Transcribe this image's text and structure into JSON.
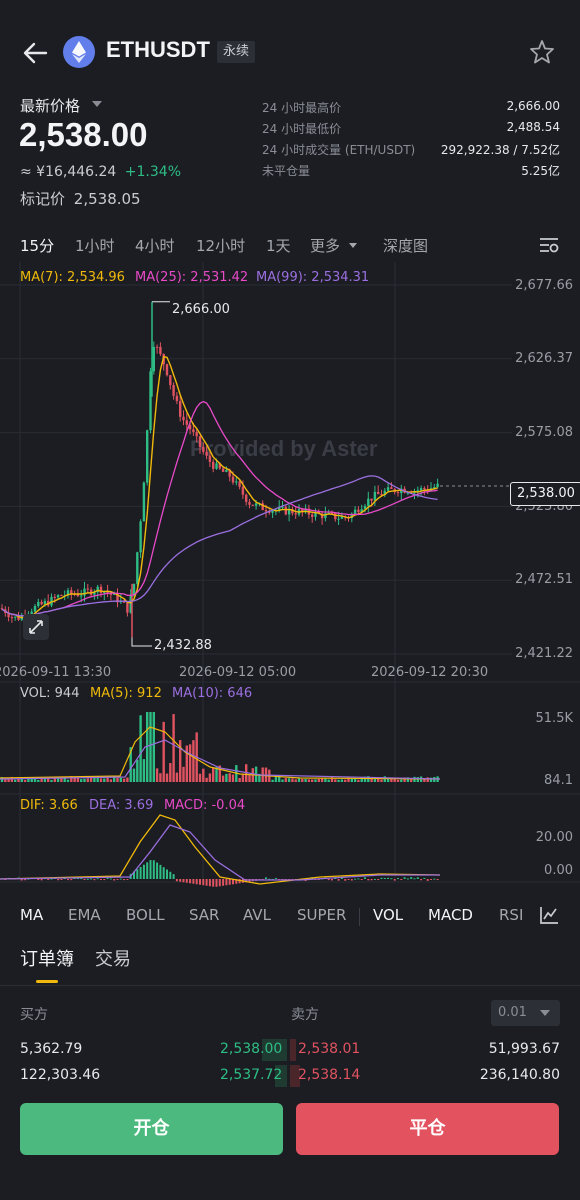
{
  "header": {
    "symbol": "ETHUSDT",
    "badge": "永续"
  },
  "price": {
    "latest_label": "最新价格",
    "last": "2,538.00",
    "cny": "≈ ¥16,446.24",
    "change_pct": "+1.34%",
    "mark_label": "标记价",
    "mark_value": "2,538.05"
  },
  "stats": [
    {
      "label": "24 小时最高价",
      "value": "2,666.00"
    },
    {
      "label": "24 小时最低价",
      "value": "2,488.54"
    },
    {
      "label": "24 小时成交量 (ETH/USDT)",
      "value": "292,922.38 / 7.52亿"
    },
    {
      "label": "未平仓量",
      "value": "5.25亿"
    }
  ],
  "timeframes": [
    "15分",
    "1小时",
    "4小时",
    "12小时",
    "1天",
    "更多",
    "深度图"
  ],
  "active_timeframe": "15分",
  "chart_data": {
    "type": "candlestick",
    "watermark": "Provided by Aster",
    "ma_legend": [
      "MA(7): 2,534.96",
      "MA(25): 2,531.42",
      "MA(99): 2,534.31"
    ],
    "y_ticks": [
      "2,677.66",
      "2,626.37",
      "2,575.08",
      "2,523.80",
      "2,472.51",
      "2,421.22"
    ],
    "x_ticks": [
      "2026-09-11 13:30",
      "2026-09-12 05:00",
      "2026-09-12 20:30"
    ],
    "last_price_tag": "2,538.00",
    "high_label": "2,666.00",
    "low_label": "2,432.88",
    "ylim": [
      2421.22,
      2677.66
    ],
    "colors": {
      "up": "#2ebd85",
      "down": "#e05361",
      "ma7": "#f0b90b",
      "ma25": "#e84ac8",
      "ma99": "#9b6fe0"
    },
    "volume": {
      "legend": [
        "VOL: 944",
        "MA(5): 912",
        "MA(10): 646"
      ],
      "y_ticks": [
        "51.5K",
        "84.1"
      ]
    },
    "macd": {
      "legend": [
        "DIF: 3.66",
        "DEA: 3.69",
        "MACD: -0.04"
      ],
      "y_ticks": [
        "20.00",
        "0.00"
      ]
    }
  },
  "indicators": {
    "main": [
      "MA",
      "EMA",
      "BOLL",
      "SAR",
      "AVL",
      "SUPER"
    ],
    "sub": [
      "VOL",
      "MACD",
      "RSI"
    ]
  },
  "orderbook": {
    "tabs": [
      "订单簿",
      "交易"
    ],
    "buy_label": "买方",
    "sell_label": "卖方",
    "precision": "0.01",
    "rows": [
      {
        "buy_qty": "5,362.79",
        "buy_price": "2,538.00",
        "sell_price": "2,538.01",
        "sell_qty": "51,993.67"
      },
      {
        "buy_qty": "122,303.46",
        "buy_price": "2,537.72",
        "sell_price": "2,538.14",
        "sell_qty": "236,140.80"
      }
    ]
  },
  "actions": {
    "open": "开仓",
    "close": "平仓"
  }
}
